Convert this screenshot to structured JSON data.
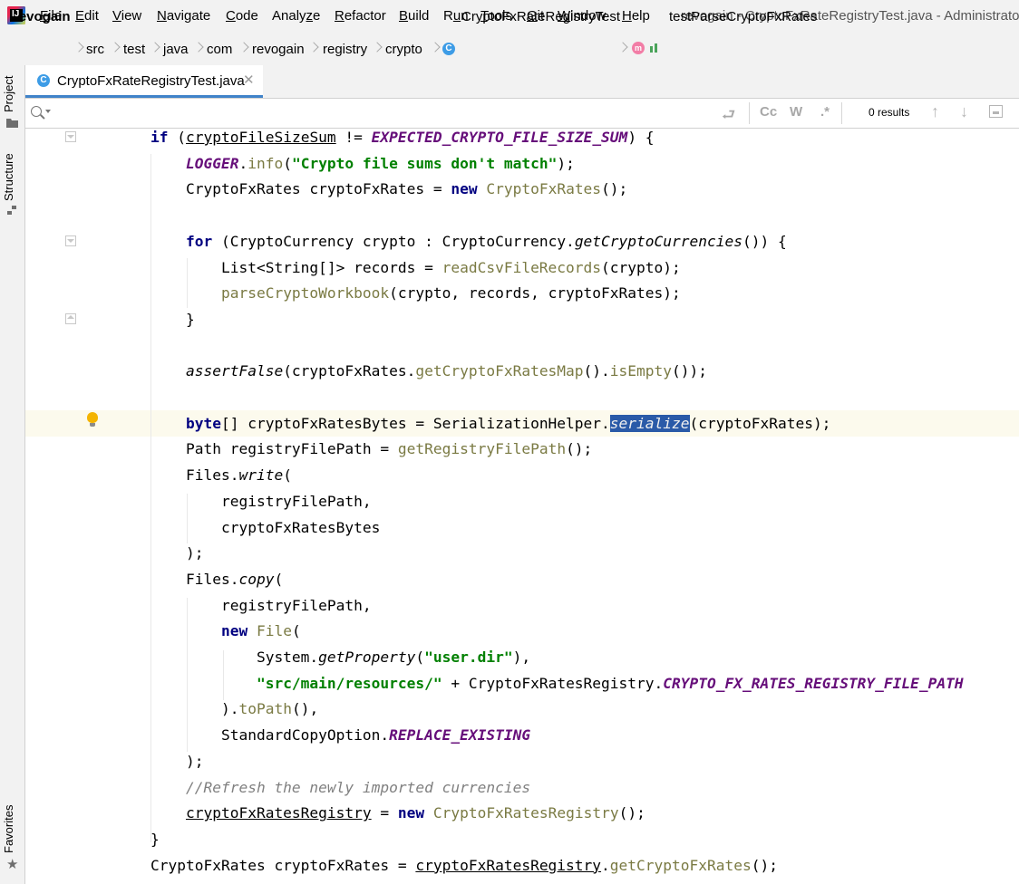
{
  "menu": {
    "items": [
      {
        "label": "File",
        "mnemonic": "F",
        "rest": "ile"
      },
      {
        "label": "Edit",
        "mnemonic": "E",
        "rest": "dit"
      },
      {
        "label": "View",
        "mnemonic": "V",
        "rest": "iew"
      },
      {
        "label": "Navigate",
        "mnemonic": "N",
        "rest": "avigate"
      },
      {
        "label": "Code",
        "mnemonic": "C",
        "rest": "ode"
      },
      {
        "label": "Analyze",
        "mnemonic": "z",
        "pre": "Analy",
        "rest": "e"
      },
      {
        "label": "Refactor",
        "mnemonic": "R",
        "rest": "efactor"
      },
      {
        "label": "Build",
        "mnemonic": "B",
        "rest": "uild"
      },
      {
        "label": "Run",
        "mnemonic": "u",
        "pre": "R",
        "rest": "n"
      },
      {
        "label": "Tools",
        "mnemonic": "T",
        "rest": "ools"
      },
      {
        "label": "Git",
        "mnemonic": "G",
        "rest": "it"
      },
      {
        "label": "Window",
        "mnemonic": "W",
        "rest": "indow"
      },
      {
        "label": "Help",
        "mnemonic": "H",
        "rest": "elp"
      }
    ],
    "window_title": "revogain - CryptoFxRateRegistryTest.java - Administrator"
  },
  "breadcrumb": {
    "project": "revogain",
    "parts": [
      "src",
      "test",
      "java",
      "com",
      "revogain",
      "registry",
      "crypto"
    ],
    "class_name": "CryptoFxRateRegistryTest",
    "method_name": "testParseCryptoFxRates",
    "class_icon_letter": "C",
    "method_icon_letter": "m"
  },
  "left_strip": {
    "project_label": "Project",
    "structure_label": "Structure",
    "favorites_label": "Favorites"
  },
  "tabs": [
    {
      "label": "CryptoFxRateRegistryTest.java",
      "active": true
    }
  ],
  "search": {
    "placeholder": "",
    "match_case_label": "Cc",
    "words_label": "W",
    "regex_label": ".*",
    "results_label": "0 results"
  },
  "colors": {
    "keyword": "#000080",
    "constant": "#660e7a",
    "string": "#008000",
    "method": "#7a7a43",
    "comment": "#808080",
    "selection": "#2a5aa8",
    "caret_line": "#fcfaed",
    "tab_underline": "#4083c9"
  },
  "code_lines": [
    [
      [
        "k",
        "if"
      ],
      [
        "p",
        " ("
      ],
      [
        "f",
        "cryptoFileSizeSum"
      ],
      [
        "p",
        " != "
      ],
      [
        "c",
        "EXPECTED_CRYPTO_FILE_SIZE_SUM"
      ],
      [
        "p",
        ") {"
      ]
    ],
    [
      [
        "p",
        "    "
      ],
      [
        "c",
        "LOGGER"
      ],
      [
        "p",
        "."
      ],
      [
        "m",
        "info"
      ],
      [
        "p",
        "("
      ],
      [
        "s",
        "\"Crypto file sums don't match\""
      ],
      [
        "p",
        ");"
      ]
    ],
    [
      [
        "p",
        "    CryptoFxRates cryptoFxRates = "
      ],
      [
        "k",
        "new"
      ],
      [
        "p",
        " "
      ],
      [
        "m",
        "CryptoFxRates"
      ],
      [
        "p",
        "();"
      ]
    ],
    [],
    [
      [
        "p",
        "    "
      ],
      [
        "k",
        "for"
      ],
      [
        "p",
        " (CryptoCurrency crypto : CryptoCurrency."
      ],
      [
        "i",
        "getCryptoCurrencies"
      ],
      [
        "p",
        "()) {"
      ]
    ],
    [
      [
        "p",
        "        List<String[]> records = "
      ],
      [
        "m",
        "readCsvFileRecords"
      ],
      [
        "p",
        "(crypto);"
      ]
    ],
    [
      [
        "p",
        "        "
      ],
      [
        "m",
        "parseCryptoWorkbook"
      ],
      [
        "p",
        "(crypto, records, cryptoFxRates);"
      ]
    ],
    [
      [
        "p",
        "    }"
      ]
    ],
    [],
    [
      [
        "p",
        "    "
      ],
      [
        "i",
        "assertFalse"
      ],
      [
        "p",
        "(cryptoFxRates."
      ],
      [
        "m",
        "getCryptoFxRatesMap"
      ],
      [
        "p",
        "()."
      ],
      [
        "m",
        "isEmpty"
      ],
      [
        "p",
        "());"
      ]
    ],
    [],
    [
      [
        "p",
        "    "
      ],
      [
        "k",
        "byte"
      ],
      [
        "p",
        "[] cryptoFxRatesBytes = SerializationHelper."
      ],
      [
        "x",
        "serialize"
      ],
      [
        "p",
        "(cryptoFxRates);"
      ]
    ],
    [
      [
        "p",
        "    Path registryFilePath = "
      ],
      [
        "m",
        "getRegistryFilePath"
      ],
      [
        "p",
        "();"
      ]
    ],
    [
      [
        "p",
        "    Files."
      ],
      [
        "i",
        "write"
      ],
      [
        "p",
        "("
      ]
    ],
    [
      [
        "p",
        "        registryFilePath,"
      ]
    ],
    [
      [
        "p",
        "        cryptoFxRatesBytes"
      ]
    ],
    [
      [
        "p",
        "    );"
      ]
    ],
    [
      [
        "p",
        "    Files."
      ],
      [
        "i",
        "copy"
      ],
      [
        "p",
        "("
      ]
    ],
    [
      [
        "p",
        "        registryFilePath,"
      ]
    ],
    [
      [
        "p",
        "        "
      ],
      [
        "k",
        "new"
      ],
      [
        "p",
        " "
      ],
      [
        "m",
        "File"
      ],
      [
        "p",
        "("
      ]
    ],
    [
      [
        "p",
        "            System."
      ],
      [
        "i",
        "getProperty"
      ],
      [
        "p",
        "("
      ],
      [
        "s",
        "\"user.dir\""
      ],
      [
        "p",
        "),"
      ]
    ],
    [
      [
        "p",
        "            "
      ],
      [
        "s",
        "\"src/main/resources/\""
      ],
      [
        "p",
        " + CryptoFxRatesRegistry."
      ],
      [
        "c",
        "CRYPTO_FX_RATES_REGISTRY_FILE_PATH"
      ]
    ],
    [
      [
        "p",
        "        )."
      ],
      [
        "m",
        "toPath"
      ],
      [
        "p",
        "(),"
      ]
    ],
    [
      [
        "p",
        "        StandardCopyOption."
      ],
      [
        "c",
        "REPLACE_EXISTING"
      ]
    ],
    [
      [
        "p",
        "    );"
      ]
    ],
    [
      [
        "p",
        "    "
      ],
      [
        "t",
        "//Refresh the newly imported currencies"
      ]
    ],
    [
      [
        "p",
        "    "
      ],
      [
        "f",
        "cryptoFxRatesRegistry"
      ],
      [
        "p",
        " = "
      ],
      [
        "k",
        "new"
      ],
      [
        "p",
        " "
      ],
      [
        "m",
        "CryptoFxRatesRegistry"
      ],
      [
        "p",
        "();"
      ]
    ],
    [
      [
        "p",
        "}"
      ]
    ],
    [
      [
        "p",
        "CryptoFxRates cryptoFxRates = "
      ],
      [
        "f",
        "cryptoFxRatesRegistry"
      ],
      [
        "p",
        "."
      ],
      [
        "m",
        "getCryptoFxRates"
      ],
      [
        "p",
        "();"
      ]
    ]
  ]
}
